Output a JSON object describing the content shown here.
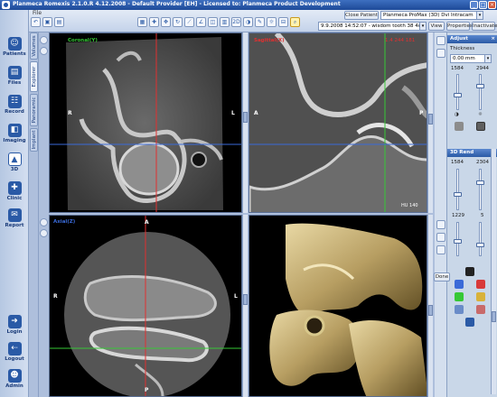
{
  "window": {
    "title": "Planmeca Romexis 2.1.0.R  4.12.2008 - Default Provider [EH] - Licensed to: Planmeca Product Development",
    "menu_file": "File"
  },
  "sidebar": {
    "items": [
      {
        "label": "Patients",
        "icon": "patients-icon"
      },
      {
        "label": "Files",
        "icon": "files-icon"
      },
      {
        "label": "Record",
        "icon": "record-icon"
      },
      {
        "label": "Imaging",
        "icon": "imaging-icon"
      },
      {
        "label": "3D",
        "icon": "3d-icon"
      },
      {
        "label": "Clinic",
        "icon": "clinic-icon"
      },
      {
        "label": "Report",
        "icon": "report-icon"
      },
      {
        "label": "Login",
        "icon": "login-icon"
      },
      {
        "label": "Logout",
        "icon": "logout-icon"
      },
      {
        "label": "Admin",
        "icon": "admin-icon"
      }
    ]
  },
  "vertical_tabs": [
    "Volumes",
    "Explorer",
    "Panoramic",
    "Implant"
  ],
  "toolbar": {
    "close_patient": "Close Patient",
    "device": "Planmeca ProMax (3D) Dvi Intracam",
    "study": "9.9.2008 14:52:07 - wisdom tooth 38 4c...",
    "view": "View",
    "properties": "Properties",
    "inactivate": "Inactivate",
    "zoom_label": "2D"
  },
  "views": {
    "coronal": {
      "label": "Coronal(Y)",
      "color": "#36c836",
      "orient_left": "R",
      "orient_right": "L"
    },
    "sagittal": {
      "label": "Sagittal(X)",
      "color": "#e03030",
      "orient_left": "A",
      "orient_right": "P",
      "hu": "HU 140",
      "coord": "1.4 244 181"
    },
    "axial": {
      "label": "Axial(Z)",
      "color": "#3a6ad8",
      "orient_top": "A",
      "orient_bottom": "P",
      "orient_left": "R",
      "orient_right": "L"
    },
    "render3d": {
      "done_label": "Done"
    }
  },
  "adjust": {
    "title": "Adjust",
    "thickness_label": "Thickness",
    "thickness_value": "0.00 mm",
    "range_low": "1584",
    "range_high": "2944"
  },
  "render_3d": {
    "title": "3D Rend",
    "range_low": "1584",
    "range_high": "2304",
    "value_a": "1229",
    "value_b": "5"
  }
}
